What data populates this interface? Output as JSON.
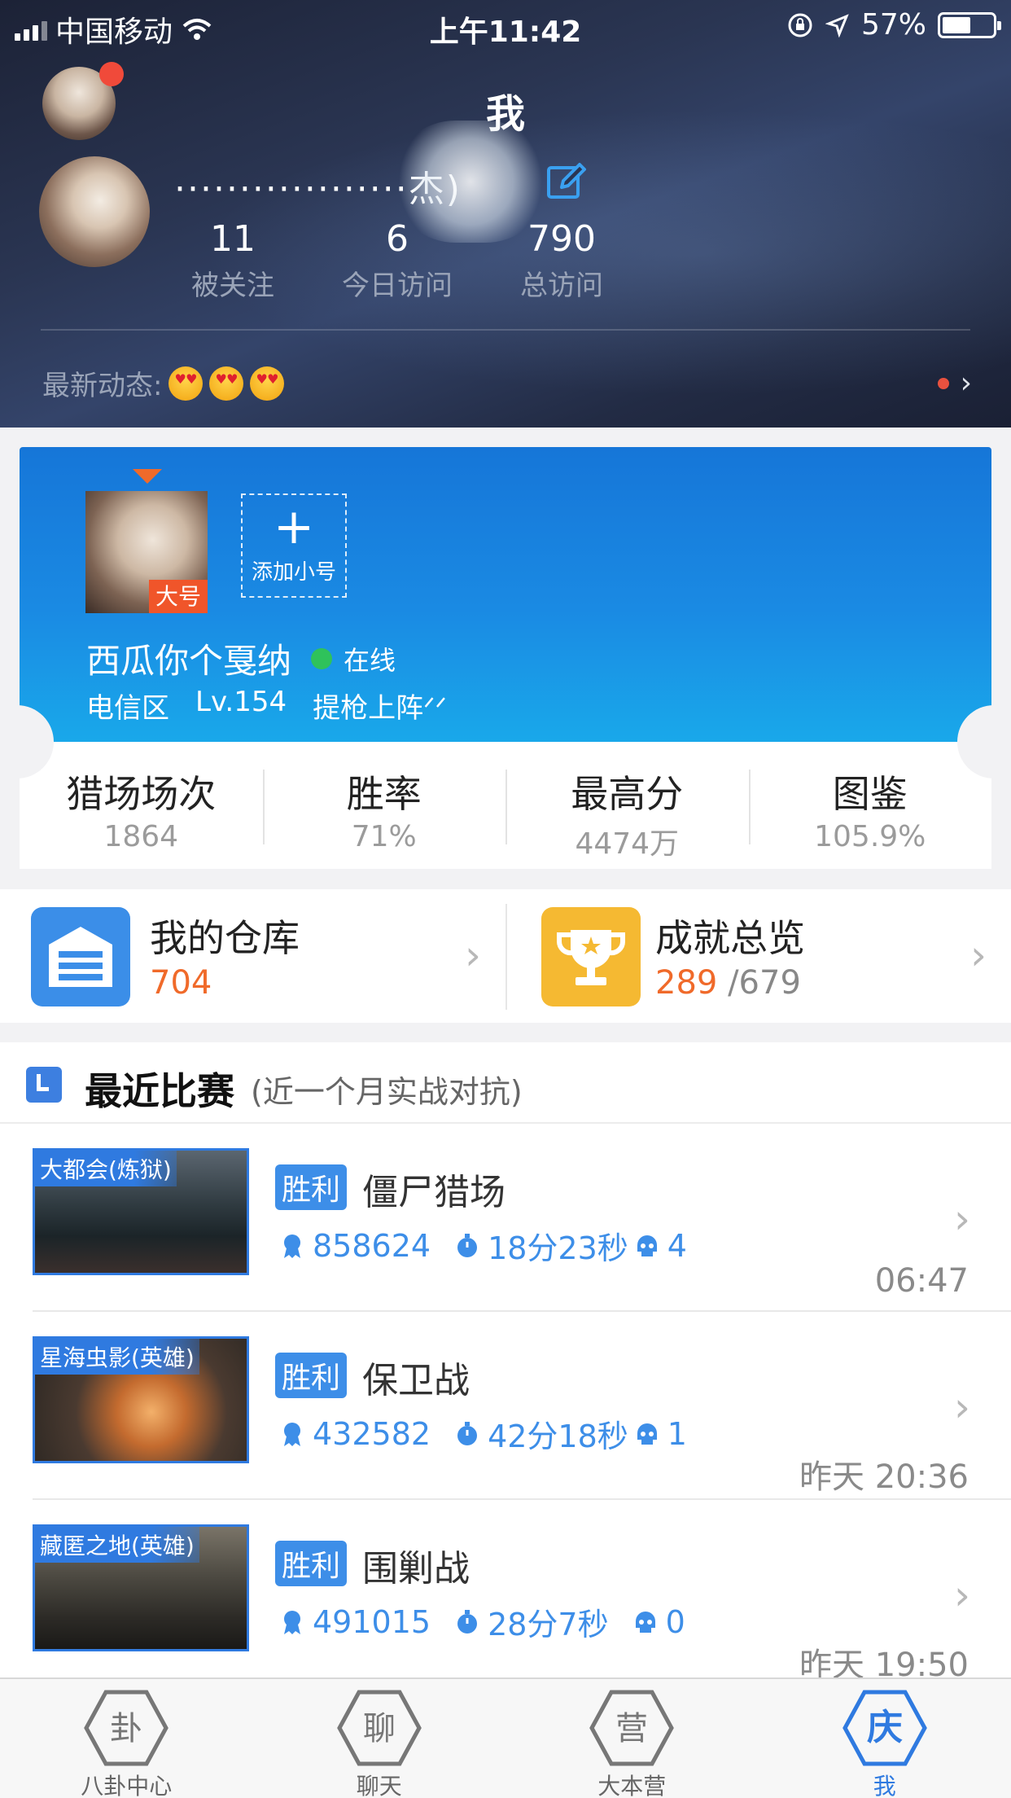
{
  "status_bar": {
    "carrier": "中国移动",
    "time": "上午11:42",
    "battery": "57%",
    "battery_level": 0.57
  },
  "header": {
    "title": "我",
    "nickname": "··················杰)",
    "stats": [
      {
        "value": "11",
        "label": "被关注"
      },
      {
        "value": "6",
        "label": "今日访问"
      },
      {
        "value": "790",
        "label": "总访问"
      }
    ],
    "latest_label": "最新动态:"
  },
  "account": {
    "main_badge": "大号",
    "add_sub_label": "添加小号",
    "name": "西瓜你个戛纳",
    "status": "在线",
    "server": "电信区",
    "level": "Lv.154",
    "title": "提枪上阵ᐟᐟ"
  },
  "game_stats": [
    {
      "label": "猎场场次",
      "value": "1864"
    },
    {
      "label": "胜率",
      "value": "71%"
    },
    {
      "label": "最高分",
      "value": "4474万"
    },
    {
      "label": "图鉴",
      "value": "105.9%"
    }
  ],
  "warehouse": {
    "title": "我的仓库",
    "count": "704"
  },
  "achievement": {
    "title": "成就总览",
    "done": "289",
    "total": "/679"
  },
  "recent": {
    "title": "最近比赛",
    "subtitle": "(近一个月实战对抗)",
    "matches": [
      {
        "map": "大都会(炼狱)",
        "result": "胜利",
        "mode": "僵尸猎场",
        "score": "858624",
        "duration": "18分23秒",
        "deaths": "4",
        "time": "06:47"
      },
      {
        "map": "星海虫影(英雄)",
        "result": "胜利",
        "mode": "保卫战",
        "score": "432582",
        "duration": "42分18秒",
        "deaths": "1",
        "time": "昨天 20:36"
      },
      {
        "map": "藏匿之地(英雄)",
        "result": "胜利",
        "mode": "围剿战",
        "score": "491015",
        "duration": "28分7秒",
        "deaths": "0",
        "time": "昨天 19:50"
      }
    ]
  },
  "tabs": [
    {
      "label": "八卦中心",
      "glyph": "卦",
      "active": false
    },
    {
      "label": "聊天",
      "glyph": "聊",
      "active": false
    },
    {
      "label": "大本营",
      "glyph": "营",
      "active": false
    },
    {
      "label": "我",
      "glyph": "庆",
      "active": true
    }
  ],
  "colors": {
    "accent": "#2f7ae0",
    "orange": "#f06a2a",
    "online": "#2fc25b"
  }
}
